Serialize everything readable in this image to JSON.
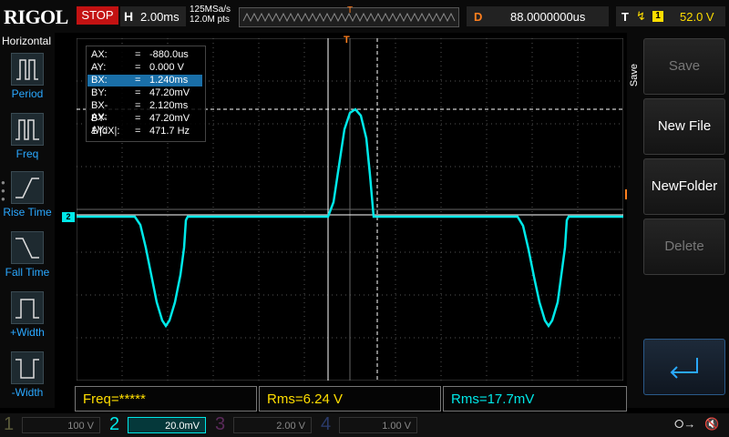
{
  "header": {
    "logo": "RIGOL",
    "run_state": "STOP",
    "timebase_label": "H",
    "timebase_value": "2.00ms",
    "sample_rate": "125MSa/s",
    "memory_depth": "12.0M pts",
    "trigger_position_marker": "T",
    "delay_label": "D",
    "delay_value": "88.0000000us",
    "trigger_label": "T",
    "trigger_edge_icon": "rising-edge-icon",
    "trigger_source": "1",
    "trigger_level": "52.0 V"
  },
  "left_panel": {
    "title": "Horizontal",
    "buttons": [
      {
        "label": "Period",
        "icon": "period-icon"
      },
      {
        "label": "Freq",
        "icon": "freq-icon"
      },
      {
        "label": "Rise Time",
        "icon": "rise-time-icon"
      },
      {
        "label": "Fall Time",
        "icon": "fall-time-icon"
      },
      {
        "label": "+Width",
        "icon": "positive-width-icon"
      },
      {
        "label": "-Width",
        "icon": "negative-width-icon"
      }
    ]
  },
  "cursor_readout": {
    "rows": [
      {
        "key": "AX:",
        "value": "-880.0us",
        "selected": false
      },
      {
        "key": "AY:",
        "value": "0.000 V",
        "selected": false
      },
      {
        "key": "BX:",
        "value": "1.240ms",
        "selected": true
      },
      {
        "key": "BY:",
        "value": "47.20mV",
        "selected": false
      },
      {
        "key": "BX-AX:",
        "value": "2.120ms",
        "selected": false
      },
      {
        "key": "BY-AY:",
        "value": "47.20mV",
        "selected": false
      },
      {
        "key": "1/|dX|:",
        "value": "471.7 Hz",
        "selected": false
      }
    ],
    "equals": "="
  },
  "waveform": {
    "channel_marker": "2",
    "trigger_level_marker": "T",
    "trace_color": "#00e8e8"
  },
  "right_panel": {
    "section_label": "Save",
    "buttons": [
      {
        "label": "Save",
        "enabled": false
      },
      {
        "label": "New File",
        "enabled": true
      },
      {
        "label": "NewFolder",
        "enabled": true
      },
      {
        "label": "Delete",
        "enabled": false
      }
    ],
    "back_icon": "return-arrow-icon"
  },
  "measurements": [
    {
      "text": "Freq=*****",
      "color": "#ffde00"
    },
    {
      "text": "Rms=6.24 V",
      "color": "#ffde00"
    },
    {
      "text": "Rms=17.7mV",
      "color": "#00e8e8"
    }
  ],
  "channels": [
    {
      "number": "1",
      "scale": "100 V",
      "color": "#ffde00",
      "active": false
    },
    {
      "number": "2",
      "scale": "20.0mV",
      "color": "#00e8e8",
      "active": true
    },
    {
      "number": "3",
      "scale": "2.00 V",
      "color": "#ff3cff",
      "active": false
    },
    {
      "number": "4",
      "scale": "1.00 V",
      "color": "#2a7fff",
      "active": false
    }
  ],
  "status": {
    "usb_icon": "usb-icon",
    "sound_icon": "mute-icon"
  }
}
